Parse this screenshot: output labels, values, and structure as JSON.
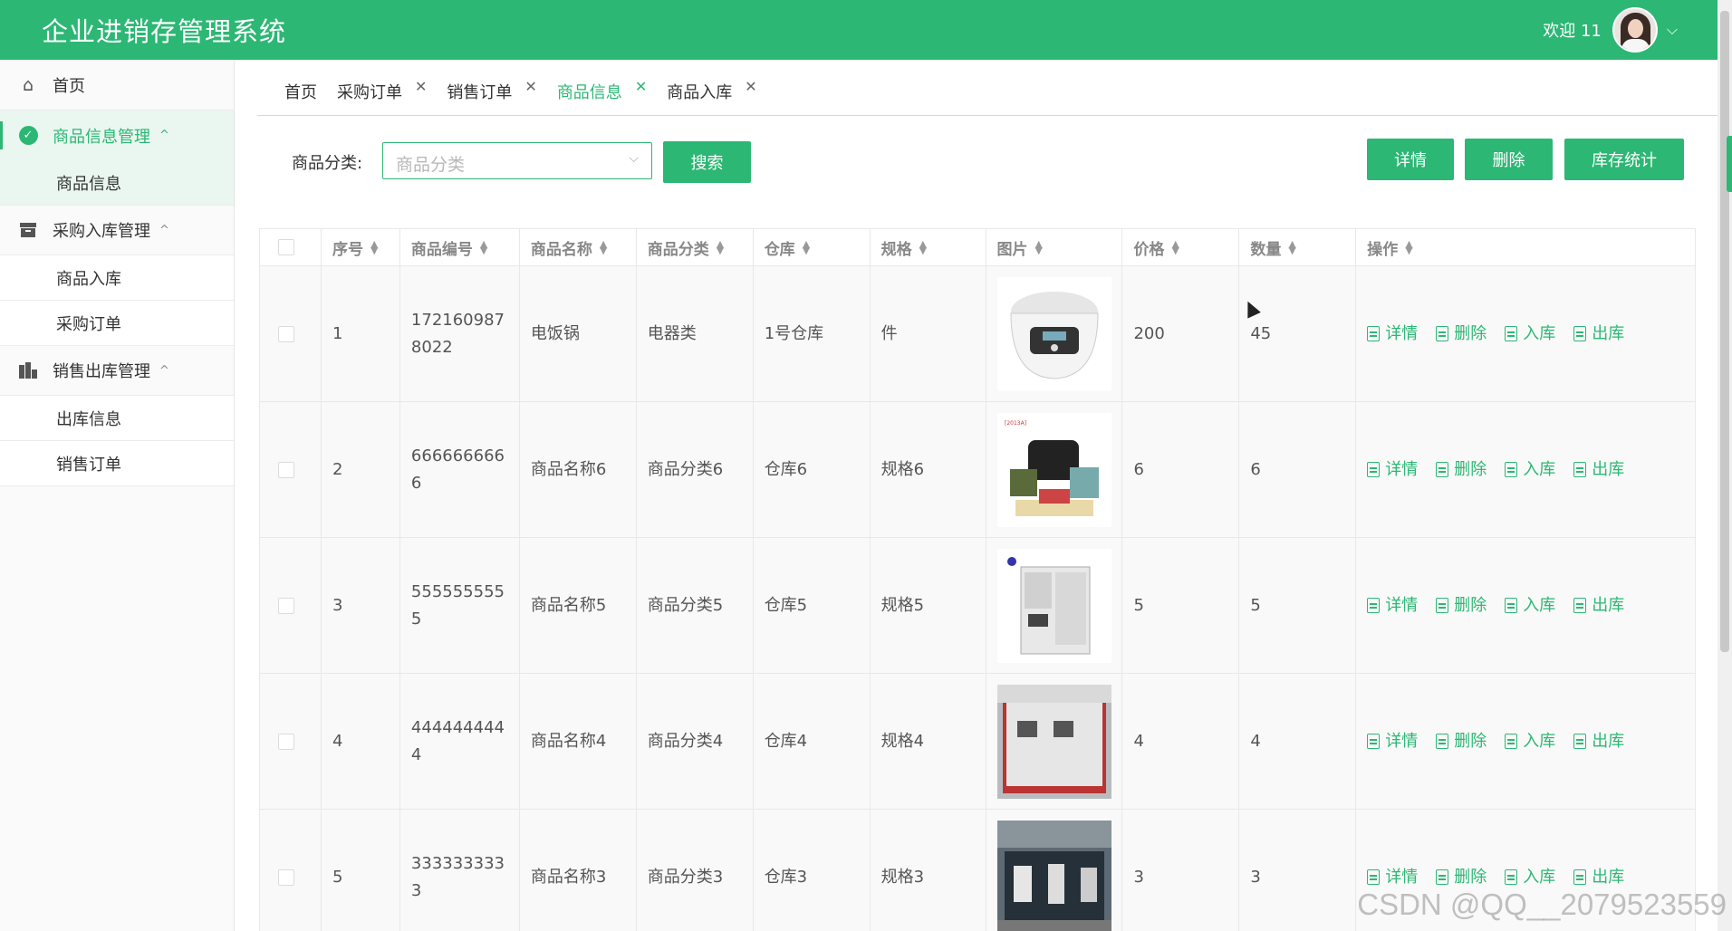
{
  "header": {
    "app_title": "企业进销存管理系统",
    "welcome": "欢迎 11",
    "brand_color": "#2cb774"
  },
  "sidebar": {
    "home": "首页",
    "groups": [
      {
        "label": "商品信息管理",
        "icon": "check-circle-icon",
        "items": [
          "商品信息"
        ]
      },
      {
        "label": "采购入库管理",
        "icon": "inbox-icon",
        "items": [
          "商品入库",
          "采购订单"
        ]
      },
      {
        "label": "销售出库管理",
        "icon": "bar-chart-icon",
        "items": [
          "出库信息",
          "销售订单"
        ]
      }
    ]
  },
  "tabs": [
    {
      "label": "首页",
      "closable": false
    },
    {
      "label": "采购订单",
      "closable": true
    },
    {
      "label": "销售订单",
      "closable": true
    },
    {
      "label": "商品信息",
      "closable": true,
      "active": true
    },
    {
      "label": "商品入库",
      "closable": true
    }
  ],
  "filter": {
    "label": "商品分类:",
    "placeholder": "商品分类",
    "search_button": "搜索"
  },
  "toolbar": {
    "detail": "详情",
    "delete": "删除",
    "stock_stats": "库存统计"
  },
  "table": {
    "columns": [
      "序号",
      "商品编号",
      "商品名称",
      "商品分类",
      "仓库",
      "规格",
      "图片",
      "价格",
      "数量",
      "操作"
    ],
    "actions": [
      "详情",
      "删除",
      "入库",
      "出库"
    ],
    "rows": [
      {
        "index": "1",
        "code": "1721609878022",
        "name": "电饭锅",
        "category": "电器类",
        "warehouse": "1号仓库",
        "spec": "件",
        "image": "rice-cooker-image",
        "price": "200",
        "qty": "45"
      },
      {
        "index": "2",
        "code": "6666666666",
        "name": "商品名称6",
        "category": "商品分类6",
        "warehouse": "仓库6",
        "spec": "规格6",
        "image": "emergency-kit-image",
        "price": "6",
        "qty": "6"
      },
      {
        "index": "3",
        "code": "5555555555",
        "name": "商品名称5",
        "category": "商品分类5",
        "warehouse": "仓库5",
        "spec": "规格5",
        "image": "test-chamber-image",
        "price": "5",
        "qty": "5"
      },
      {
        "index": "4",
        "code": "4444444444",
        "name": "商品名称4",
        "category": "商品分类4",
        "warehouse": "仓库4",
        "spec": "规格4",
        "image": "cabinet-image",
        "price": "4",
        "qty": "4"
      },
      {
        "index": "5",
        "code": "3333333333",
        "name": "商品名称3",
        "category": "商品分类3",
        "warehouse": "仓库3",
        "spec": "规格3",
        "image": "workshop-image",
        "price": "3",
        "qty": "3"
      }
    ]
  },
  "watermark": "CSDN @QQ__2079523559"
}
